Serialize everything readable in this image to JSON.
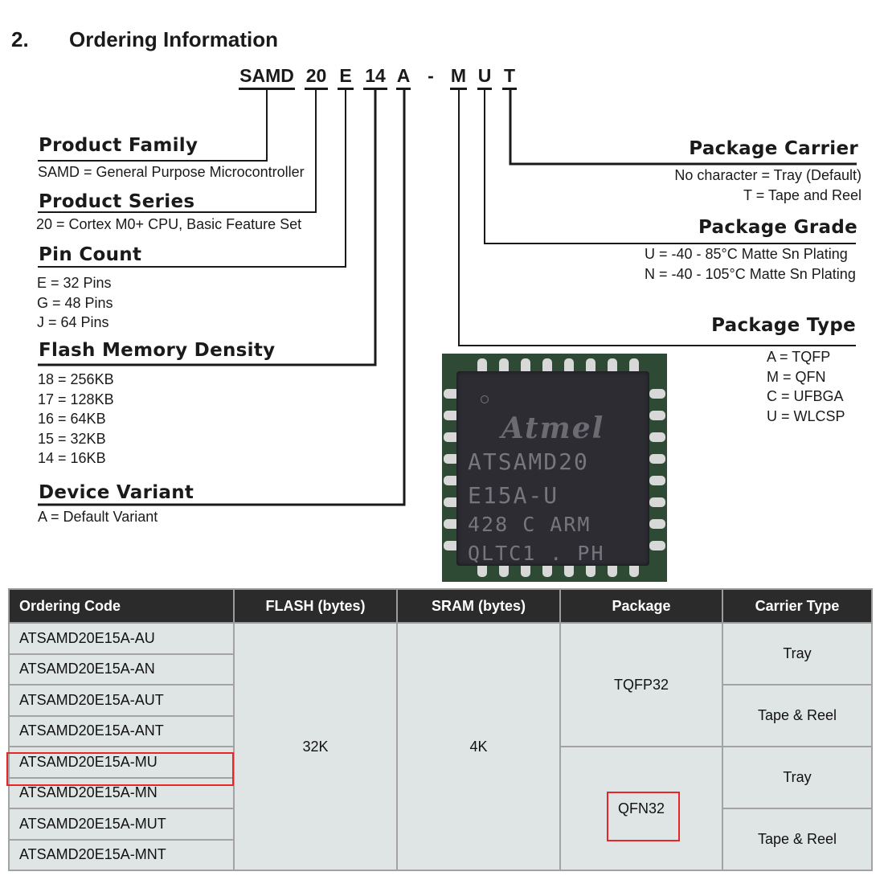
{
  "section": {
    "number": "2.",
    "title": "Ordering Information"
  },
  "code_parts": [
    {
      "text": "SAMD"
    },
    {
      "text": "20"
    },
    {
      "text": "E"
    },
    {
      "text": "14"
    },
    {
      "text": "A"
    },
    {
      "text": "-"
    },
    {
      "text": "M"
    },
    {
      "text": "U"
    },
    {
      "text": "T"
    }
  ],
  "fields": {
    "product_family": {
      "title": "Product Family",
      "lines": [
        "SAMD = General Purpose Microcontroller"
      ]
    },
    "product_series": {
      "title": "Product Series",
      "lines": [
        "20 = Cortex M0+ CPU, Basic Feature Set"
      ]
    },
    "pin_count": {
      "title": "Pin Count",
      "lines": [
        "E = 32 Pins",
        "G = 48 Pins",
        "J = 64 Pins"
      ]
    },
    "flash_density": {
      "title": "Flash Memory Density",
      "lines": [
        "18 = 256KB",
        "17 = 128KB",
        "16 = 64KB",
        "15 = 32KB",
        "14 = 16KB"
      ]
    },
    "device_variant": {
      "title": "Device Variant",
      "lines": [
        "A = Default Variant"
      ]
    },
    "package_carrier": {
      "title": "Package Carrier",
      "lines": [
        "No character = Tray (Default)",
        "T = Tape and Reel"
      ]
    },
    "package_grade": {
      "title": "Package Grade",
      "lines": [
        "U = -40 - 85°C Matte Sn Plating",
        "N = -40 - 105°C Matte Sn Plating"
      ]
    },
    "package_type": {
      "title": "Package Type",
      "lines": [
        "A = TQFP",
        "M = QFN",
        "C = UFBGA",
        "U = WLCSP"
      ]
    }
  },
  "chip_photo": {
    "logo": "Atmel",
    "marking_lines": [
      "ATSAMD20",
      "E15A-U",
      "428 C ARM",
      "QLTC1 . PH"
    ]
  },
  "table": {
    "headers": [
      "Ordering Code",
      "FLASH (bytes)",
      "SRAM (bytes)",
      "Package",
      "Carrier Type"
    ],
    "ordering_codes": [
      "ATSAMD20E15A-AU",
      "ATSAMD20E15A-AN",
      "ATSAMD20E15A-AUT",
      "ATSAMD20E15A-ANT",
      "ATSAMD20E15A-MU",
      "ATSAMD20E15A-MN",
      "ATSAMD20E15A-MUT",
      "ATSAMD20E15A-MNT"
    ],
    "flash": "32K",
    "sram": "4K",
    "packages": [
      "TQFP32",
      "QFN32"
    ],
    "carriers": [
      "Tray",
      "Tape & Reel",
      "Tray",
      "Tape & Reel"
    ],
    "highlighted": [
      "ATSAMD20E15A-MU",
      "QFN32"
    ]
  },
  "colors": {
    "highlight": "#e8262a",
    "header_bg": "#2b2b2b",
    "cell_bg": "#dfe5e4"
  }
}
